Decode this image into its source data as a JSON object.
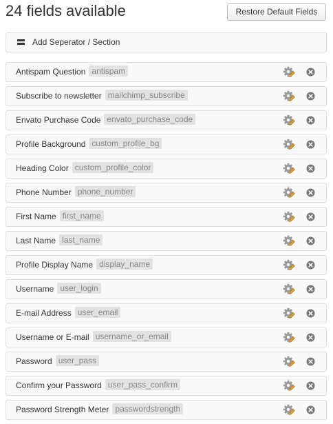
{
  "header": {
    "title": "24 fields available",
    "restore_label": "Restore Default Fields"
  },
  "separator": {
    "label": "Add Seperator / Section",
    "icon": "separator-icon"
  },
  "row_icons": {
    "edit": "settings-gear-icon",
    "remove": "remove-circle-x-icon"
  },
  "colors": {
    "row_background": "#f9f9f9",
    "row_border": "#dfdfdf",
    "key_badge_background": "#e2e2e2",
    "key_badge_text": "#888888",
    "gear": "#999999",
    "gear_pencil": "#e6a02a",
    "remove_icon": "#777777"
  },
  "fields": [
    {
      "label": "Antispam Question",
      "key": "antispam"
    },
    {
      "label": "Subscribe to newsletter",
      "key": "mailchimp_subscribe"
    },
    {
      "label": "Envato Purchase Code",
      "key": "envato_purchase_code"
    },
    {
      "label": "Profile Background",
      "key": "custom_profile_bg"
    },
    {
      "label": "Heading Color",
      "key": "custom_profile_color"
    },
    {
      "label": "Phone Number",
      "key": "phone_number"
    },
    {
      "label": "First Name",
      "key": "first_name"
    },
    {
      "label": "Last Name",
      "key": "last_name"
    },
    {
      "label": "Profile Display Name",
      "key": "display_name"
    },
    {
      "label": "Username",
      "key": "user_login"
    },
    {
      "label": "E-mail Address",
      "key": "user_email"
    },
    {
      "label": "Username or E-mail",
      "key": "username_or_email"
    },
    {
      "label": "Password",
      "key": "user_pass"
    },
    {
      "label": "Confirm your Password",
      "key": "user_pass_confirm"
    },
    {
      "label": "Password Strength Meter",
      "key": "passwordstrength"
    }
  ]
}
